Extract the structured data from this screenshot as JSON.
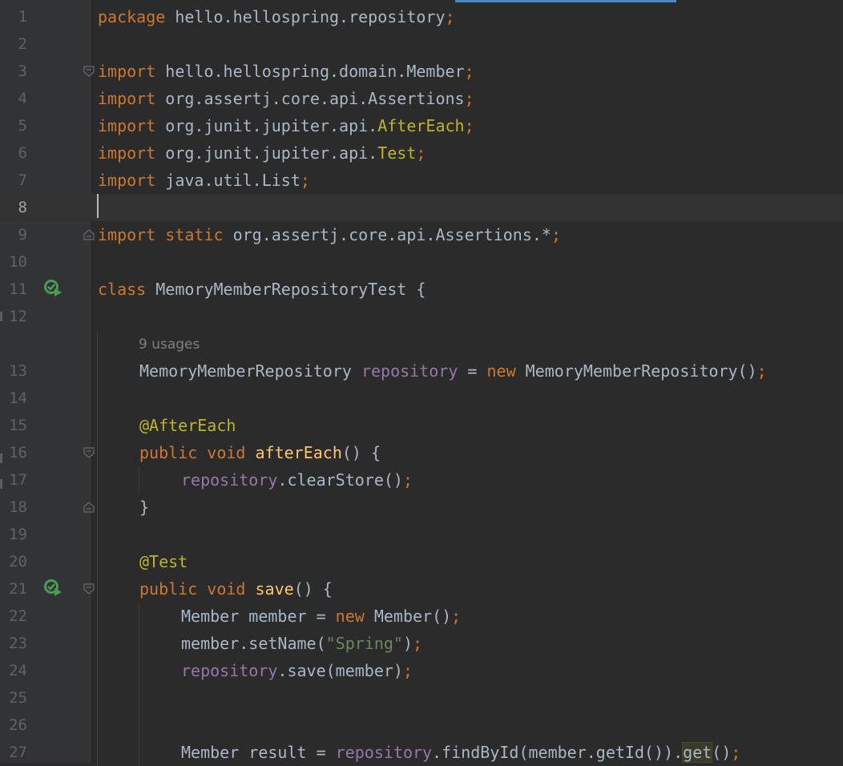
{
  "editor": {
    "lines": [
      {
        "n": "1",
        "tokens": [
          {
            "t": "package",
            "c": "kw"
          },
          {
            "t": " hello.hellospring.repository"
          },
          {
            "t": ";",
            "c": "kw"
          }
        ]
      },
      {
        "n": "2",
        "tokens": []
      },
      {
        "n": "3",
        "tokens": [
          {
            "t": "import",
            "c": "kw"
          },
          {
            "t": " hello.hellospring.domain.Member"
          },
          {
            "t": ";",
            "c": "kw"
          }
        ],
        "fold": "open"
      },
      {
        "n": "4",
        "tokens": [
          {
            "t": "import",
            "c": "kw"
          },
          {
            "t": " org.assertj.core.api.Assertions"
          },
          {
            "t": ";",
            "c": "kw"
          }
        ]
      },
      {
        "n": "5",
        "tokens": [
          {
            "t": "import",
            "c": "kw"
          },
          {
            "t": " org.junit.jupiter.api."
          },
          {
            "t": "AfterEach",
            "c": "an"
          },
          {
            "t": ";",
            "c": "kw"
          }
        ]
      },
      {
        "n": "6",
        "tokens": [
          {
            "t": "import",
            "c": "kw"
          },
          {
            "t": " org.junit.jupiter.api."
          },
          {
            "t": "Test",
            "c": "an"
          },
          {
            "t": ";",
            "c": "kw"
          }
        ]
      },
      {
        "n": "7",
        "tokens": [
          {
            "t": "import",
            "c": "kw"
          },
          {
            "t": " java.util.List"
          },
          {
            "t": ";",
            "c": "kw"
          }
        ]
      },
      {
        "n": "8",
        "tokens": [],
        "current": true
      },
      {
        "n": "9",
        "tokens": [
          {
            "t": "import",
            "c": "kw"
          },
          {
            "t": " "
          },
          {
            "t": "static",
            "c": "kw"
          },
          {
            "t": " org.assertj.core.api.Assertions.*"
          },
          {
            "t": ";",
            "c": "kw"
          }
        ],
        "fold": "close"
      },
      {
        "n": "10",
        "tokens": []
      },
      {
        "n": "11",
        "tokens": [
          {
            "t": "class",
            "c": "kw"
          },
          {
            "t": " MemoryMemberRepositoryTest {"
          }
        ],
        "run": true
      },
      {
        "n": "12",
        "tokens": []
      },
      {
        "n": "",
        "hint": "9 usages"
      },
      {
        "n": "13",
        "indent": 1,
        "tokens": [
          {
            "t": "MemoryMemberRepository "
          },
          {
            "t": "repository",
            "c": "fld"
          },
          {
            "t": " = "
          },
          {
            "t": "new",
            "c": "kw"
          },
          {
            "t": " MemoryMemberRepository()"
          },
          {
            "t": ";",
            "c": "kw"
          }
        ]
      },
      {
        "n": "14",
        "tokens": []
      },
      {
        "n": "15",
        "indent": 1,
        "tokens": [
          {
            "t": "@AfterEach",
            "c": "an"
          }
        ]
      },
      {
        "n": "16",
        "indent": 1,
        "tokens": [
          {
            "t": "public",
            "c": "kw"
          },
          {
            "t": " "
          },
          {
            "t": "void",
            "c": "kw"
          },
          {
            "t": " "
          },
          {
            "t": "afterEach",
            "c": "fn"
          },
          {
            "t": "() {"
          }
        ],
        "fold": "open"
      },
      {
        "n": "17",
        "indent": 2,
        "tokens": [
          {
            "t": "repository",
            "c": "fld"
          },
          {
            "t": ".clearStore()"
          },
          {
            "t": ";",
            "c": "kw"
          }
        ]
      },
      {
        "n": "18",
        "indent": 1,
        "tokens": [
          {
            "t": "}"
          }
        ],
        "fold": "close"
      },
      {
        "n": "19",
        "tokens": []
      },
      {
        "n": "20",
        "indent": 1,
        "tokens": [
          {
            "t": "@Test",
            "c": "an"
          }
        ]
      },
      {
        "n": "21",
        "indent": 1,
        "tokens": [
          {
            "t": "public",
            "c": "kw"
          },
          {
            "t": " "
          },
          {
            "t": "void",
            "c": "kw"
          },
          {
            "t": " "
          },
          {
            "t": "save",
            "c": "fn"
          },
          {
            "t": "() {"
          }
        ],
        "run": true,
        "fold": "open"
      },
      {
        "n": "22",
        "indent": 2,
        "tokens": [
          {
            "t": "Member member = "
          },
          {
            "t": "new",
            "c": "kw"
          },
          {
            "t": " Member()"
          },
          {
            "t": ";",
            "c": "kw"
          }
        ]
      },
      {
        "n": "23",
        "indent": 2,
        "tokens": [
          {
            "t": "member.setName("
          },
          {
            "t": "\"Spring\"",
            "c": "str"
          },
          {
            "t": ")"
          },
          {
            "t": ";",
            "c": "kw"
          }
        ]
      },
      {
        "n": "24",
        "indent": 2,
        "tokens": [
          {
            "t": "repository",
            "c": "fld"
          },
          {
            "t": ".save(member)"
          },
          {
            "t": ";",
            "c": "kw"
          }
        ]
      },
      {
        "n": "25",
        "tokens": []
      },
      {
        "n": "26",
        "tokens": []
      },
      {
        "n": "27",
        "indent": 2,
        "tokens": [
          {
            "t": "Member result = "
          },
          {
            "t": "repository",
            "c": "fld"
          },
          {
            "t": ".findById(member.getId())."
          },
          {
            "t": "get",
            "c": "hl"
          },
          {
            "t": "()"
          },
          {
            "t": ";",
            "c": "kw"
          }
        ]
      }
    ]
  },
  "colors": {
    "background": "#2b2b2b",
    "gutter": "#313335",
    "keyword": "#cc7832",
    "annotation": "#bbb529",
    "field": "#9876aa",
    "method": "#ffc66d",
    "string": "#6a8759",
    "text": "#a9b7c6",
    "run_icon": "#499c54"
  }
}
